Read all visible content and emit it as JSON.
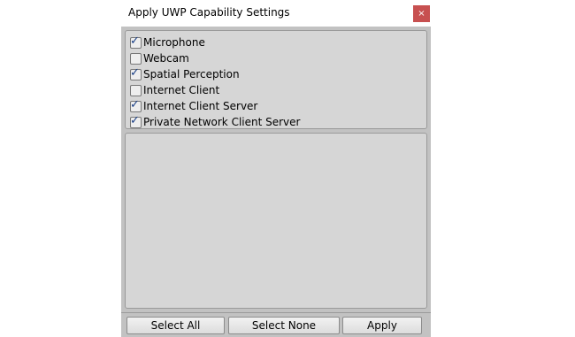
{
  "window": {
    "title": "Apply UWP Capability Settings",
    "close_glyph": "×"
  },
  "capabilities": [
    {
      "label": "Microphone",
      "checked": true
    },
    {
      "label": "Webcam",
      "checked": false
    },
    {
      "label": "Spatial Perception",
      "checked": true
    },
    {
      "label": "Internet Client",
      "checked": false
    },
    {
      "label": "Internet Client Server",
      "checked": true
    },
    {
      "label": "Private Network Client Server",
      "checked": true
    }
  ],
  "buttons": {
    "select_all": "Select All",
    "select_none": "Select None",
    "apply": "Apply"
  },
  "colors": {
    "close_button": "#c75050",
    "client_background": "#c2c2c2",
    "panel_background": "#d6d6d6",
    "checkmark": "#1a3f86"
  },
  "icons": {
    "close": "close-icon",
    "checkbox_checked": "checkmark-icon"
  }
}
